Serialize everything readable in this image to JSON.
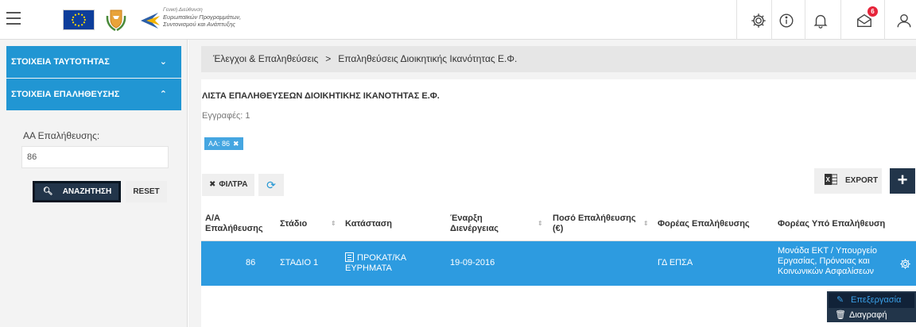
{
  "header": {
    "gs_line1": "Γενική Διεύθυνση",
    "gs_line2": "Ευρωπαϊκών Προγραμμάτων,",
    "gs_line3": "Συντονισμού και Ανάπτυξης",
    "notification_count": "6"
  },
  "sidebar": {
    "section1": "ΣΤΟΙΧΕΙΑ ΤΑΥΤΟΤΗΤΑΣ",
    "section2": "ΣΤΟΙΧΕΙΑ ΕΠΑΛΗΘΕΥΣΗΣ",
    "field_label": "ΑΑ Επαλήθευσης:",
    "field_value": "86",
    "search_label": "ΑΝΑΖΗΤΗΣΗ",
    "reset_label": "RESET"
  },
  "breadcrumb": {
    "item1": "Έλεγχοι & Επαληθεύσεις",
    "separator": ">",
    "item2": "Επαληθεύσεις Διοικητικής Ικανότητας Ε.Φ."
  },
  "list": {
    "title": "ΛΙΣΤΑ ΕΠΑΛΗΘΕΥΣΕΩΝ ΔΙΟΙΚΗΤΙΚΗΣ ΙΚΑΝΟΤΗΤΑΣ Ε.Φ.",
    "records": "Εγγραφές: 1",
    "chip": "ΑΑ: 86",
    "filters_label": "ΦΙΛΤΡΑ",
    "export_label": "EXPORT",
    "add_label": "+"
  },
  "table": {
    "columns": {
      "aa_l1": "Α/Α",
      "aa_l2": "Επαλήθευσης",
      "stage": "Στάδιο",
      "status": "Κατάσταση",
      "start_l1": "Έναρξη",
      "start_l2": "Διενέργειας",
      "amount_l1": "Ποσό Επαλήθευσης",
      "amount_l2": "(€)",
      "body": "Φορέας Επαλήθευσης",
      "target": "Φορέας Υπό Επαλήθευση"
    },
    "rows": [
      {
        "aa": "86",
        "stage": "ΣΤΑΔΙΟ 1",
        "status_l1": "ΠΡΟΚΑΤ/ΚΑ",
        "status_l2": "ΕΥΡΗΜΑΤΑ",
        "start": "19-09-2016",
        "amount": "",
        "body": "ΓΔ ΕΠΣΑ",
        "target_l1": "Μονάδα ΕΚΤ / Υπουργείο",
        "target_l2": "Εργασίας, Πρόνοιας και",
        "target_l3": "Κοινωνικών Ασφαλίσεων"
      }
    ]
  },
  "context_menu": {
    "edit": "Επεξεργασία",
    "delete": "Διαγραφή"
  }
}
